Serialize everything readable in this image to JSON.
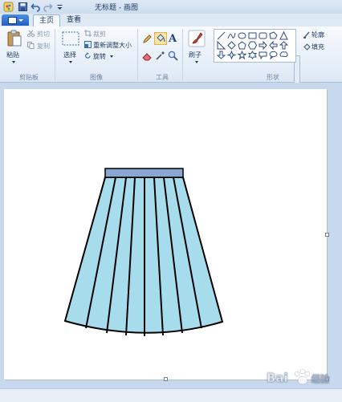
{
  "window": {
    "title": "无标题 - 画图"
  },
  "tabs": [
    {
      "label": "主页",
      "active": true
    },
    {
      "label": "查看",
      "active": false
    }
  ],
  "clipboard": {
    "paste": "粘贴",
    "cut": "剪切",
    "copy": "复制",
    "group": "剪贴板"
  },
  "image": {
    "select": "选择",
    "crop": "裁剪",
    "resize": "重新调整大小",
    "rotate": "旋转",
    "group": "图像"
  },
  "tools": {
    "group": "工具"
  },
  "brushes": {
    "label": "刷子"
  },
  "shapes": {
    "outline": "轮廓",
    "fill": "填充",
    "group": "形状"
  },
  "drawing": {
    "subject": "pleated skirt",
    "waistband_color": "#8aa7d1",
    "skirt_color": "#a7dced",
    "outline_color": "#000000"
  },
  "watermark": {
    "text": "Bai 经验"
  }
}
